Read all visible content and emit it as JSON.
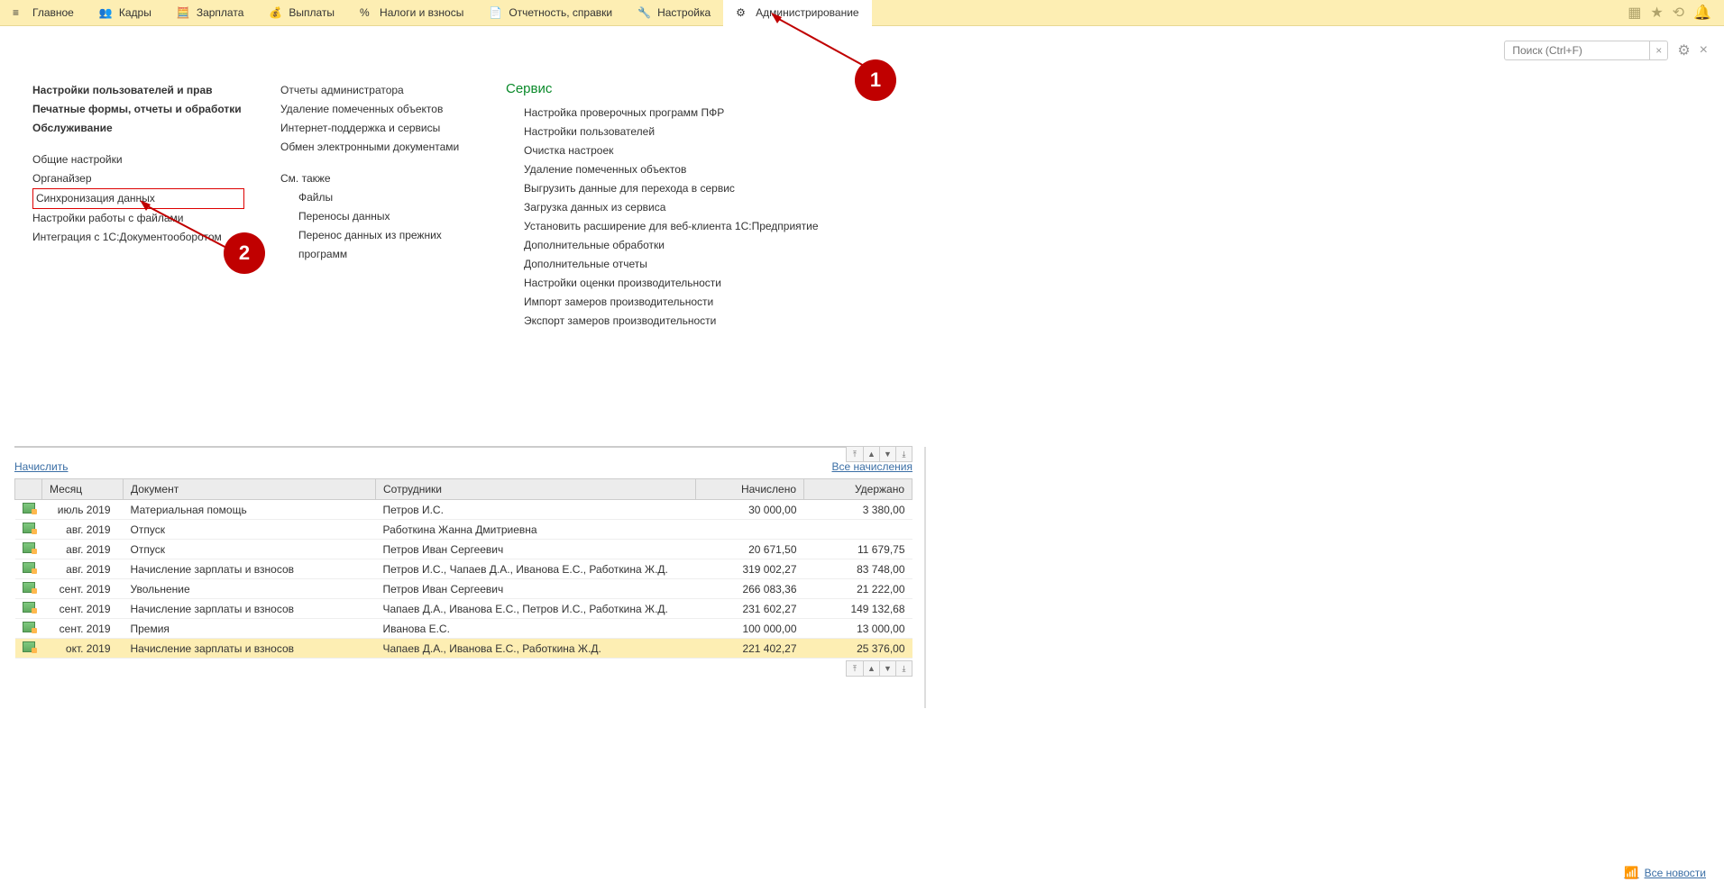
{
  "topnav": {
    "items": [
      {
        "label": "Главное"
      },
      {
        "label": "Кадры"
      },
      {
        "label": "Зарплата"
      },
      {
        "label": "Выплаты"
      },
      {
        "label": "Налоги и взносы"
      },
      {
        "label": "Отчетность, справки"
      },
      {
        "label": "Настройка"
      },
      {
        "label": "Администрирование"
      }
    ]
  },
  "search": {
    "placeholder": "Поиск (Ctrl+F)"
  },
  "admin_panel": {
    "col1": {
      "bold": [
        "Настройки пользователей и прав",
        "Печатные формы, отчеты и обработки",
        "Обслуживание"
      ],
      "links": [
        "Общие настройки",
        "Органайзер",
        "Синхронизация данных",
        "Настройки работы с файлами",
        "Интеграция с 1С:Документооборотом"
      ]
    },
    "col2": {
      "links": [
        "Отчеты администратора",
        "Удаление помеченных объектов",
        "Интернет-поддержка и сервисы",
        "Обмен электронными документами"
      ],
      "see_also_hdr": "См. также",
      "see_also": [
        "Файлы",
        "Переносы данных",
        "Перенос данных из прежних программ"
      ]
    },
    "col3": {
      "hdr": "Сервис",
      "links": [
        "Настройка проверочных программ ПФР",
        "Настройки пользователей",
        "Очистка настроек",
        "Удаление помеченных объектов",
        "Выгрузить данные для перехода в сервис",
        "Загрузка данных из сервиса",
        "Установить расширение для веб-клиента 1С:Предприятие",
        "Дополнительные обработки",
        "Дополнительные отчеты",
        "Настройки оценки производительности",
        "Импорт замеров производительности",
        "Экспорт замеров производительности"
      ]
    }
  },
  "callouts": {
    "b1": "1",
    "b2": "2"
  },
  "grid": {
    "link_compute": "Начислить",
    "link_all": "Все начисления",
    "cols": [
      "Месяц",
      "Документ",
      "Сотрудники",
      "Начислено",
      "Удержано"
    ],
    "rows": [
      {
        "m": "июль 2019",
        "d": "Материальная помощь",
        "s": "Петров И.С.",
        "a": "30 000,00",
        "u": "3 380,00"
      },
      {
        "m": "авг. 2019",
        "d": "Отпуск",
        "s": "Работкина Жанна Дмитриевна",
        "a": "",
        "u": ""
      },
      {
        "m": "авг. 2019",
        "d": "Отпуск",
        "s": "Петров Иван Сергеевич",
        "a": "20 671,50",
        "u": "11 679,75"
      },
      {
        "m": "авг. 2019",
        "d": "Начисление зарплаты и взносов",
        "s": "Петров И.С., Чапаев Д.А., Иванова Е.С., Работкина Ж.Д.",
        "a": "319 002,27",
        "u": "83 748,00"
      },
      {
        "m": "сент. 2019",
        "d": "Увольнение",
        "s": "Петров Иван Сергеевич",
        "a": "266 083,36",
        "u": "21 222,00"
      },
      {
        "m": "сент. 2019",
        "d": "Начисление зарплаты и взносов",
        "s": "Чапаев Д.А., Иванова Е.С., Петров И.С., Работкина Ж.Д.",
        "a": "231 602,27",
        "u": "149 132,68"
      },
      {
        "m": "сент. 2019",
        "d": "Премия",
        "s": "Иванова Е.С.",
        "a": "100 000,00",
        "u": "13 000,00"
      },
      {
        "m": "окт. 2019",
        "d": "Начисление зарплаты и взносов",
        "s": "Чапаев Д.А., Иванова Е.С., Работкина Ж.Д.",
        "a": "221 402,27",
        "u": "25 376,00"
      }
    ]
  },
  "all_news": "Все новости"
}
